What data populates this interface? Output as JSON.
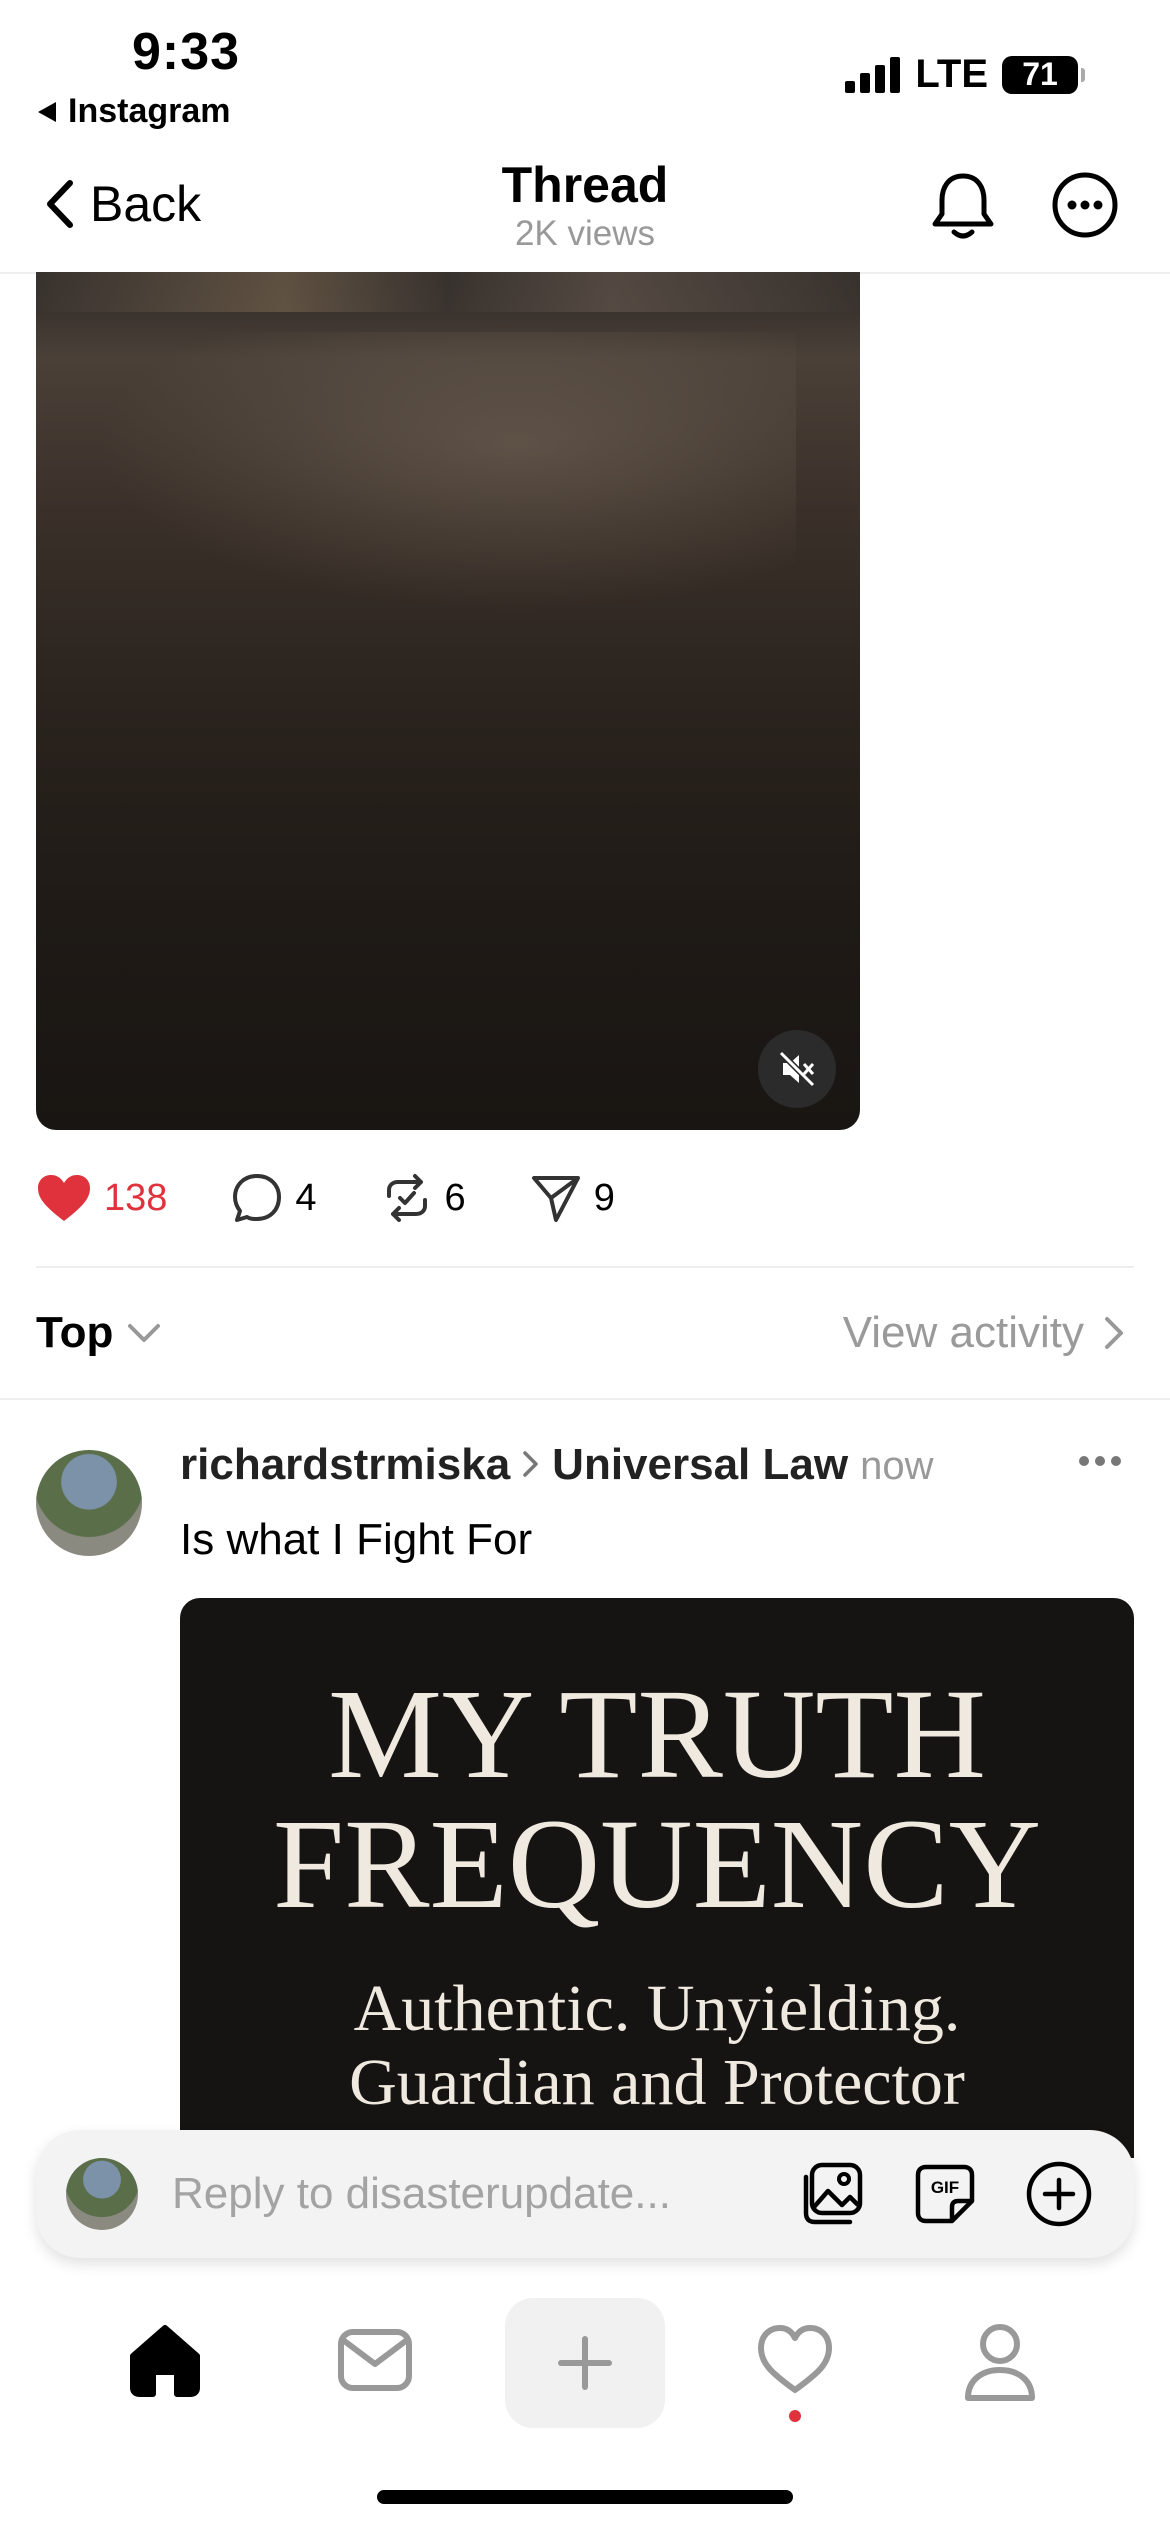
{
  "status_bar": {
    "time": "9:33",
    "back_app": "Instagram",
    "network": "LTE",
    "battery": "71"
  },
  "header": {
    "back_label": "Back",
    "title": "Thread",
    "subtitle": "2K views",
    "icons": [
      "bell-icon",
      "more-icon"
    ]
  },
  "post": {
    "likes": "138",
    "comments": "4",
    "reposts": "6",
    "shares": "9",
    "like_color": "#e0323c"
  },
  "sort": {
    "label": "Top",
    "view_activity": "View activity"
  },
  "reply_post": {
    "username": "richardstrmiska",
    "topic": "Universal Law",
    "time": "now",
    "text": "Is what I Fight For",
    "image_text": {
      "line1": "MY TRUTH",
      "line2": "FREQUENCY",
      "line3": "Authentic. Unyielding.",
      "line4": "Guardian and Protector"
    }
  },
  "reply_bar": {
    "placeholder": "Reply to disasterupdate..."
  },
  "tab_bar": {
    "items": [
      "home-icon",
      "inbox-icon",
      "new-post-icon",
      "activity-icon",
      "profile-icon"
    ]
  }
}
